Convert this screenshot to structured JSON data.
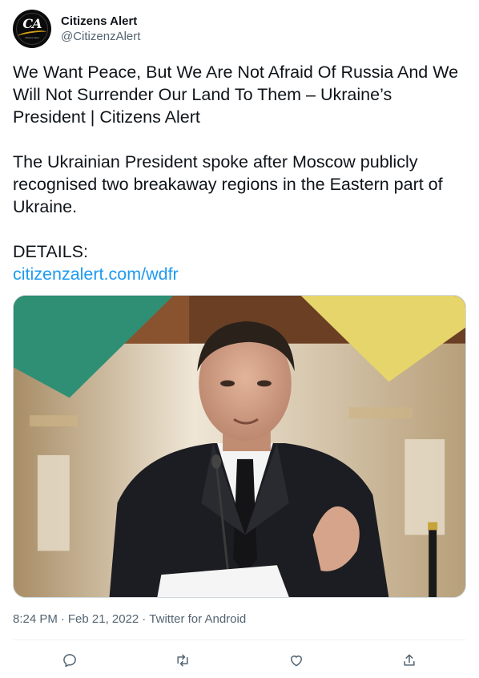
{
  "author": {
    "display_name": "Citizens Alert",
    "handle": "@CitizenzAlert",
    "avatar_initials": "CA",
    "avatar_tagline": "Citizens Alert"
  },
  "tweet": {
    "headline": "We Want Peace, But We Are Not Afraid Of Russia And We Will Not Surrender Our Land To Them – Ukraine’s President | Citizens Alert",
    "paragraph": "The Ukrainian President spoke after Moscow publicly recognised two breakaway regions in the Eastern part of Ukraine.",
    "details_label": "DETAILS:",
    "link_text": "citizenzalert.com/wdfr"
  },
  "media": {
    "kind": "photo"
  },
  "meta": {
    "time": "8:24 PM",
    "separator1": "·",
    "date": "Feb 21, 2022",
    "separator2": "·",
    "source": "Twitter for Android"
  },
  "actions": {
    "reply_icon": "reply-icon",
    "retweet_icon": "retweet-icon",
    "like_icon": "heart-icon",
    "share_icon": "share-icon"
  },
  "colors": {
    "text": "#0f1419",
    "secondary": "#536471",
    "link": "#1d9bf0",
    "divider": "#eff3f4"
  }
}
